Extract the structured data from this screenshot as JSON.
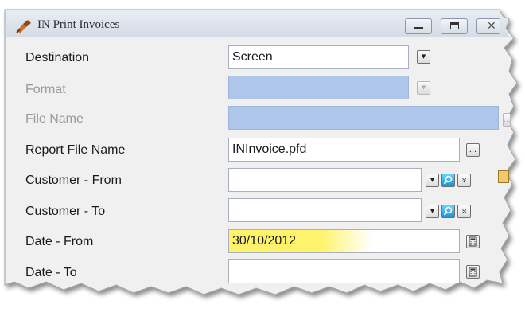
{
  "window": {
    "title": "IN Print Invoices",
    "icons": {
      "app": "satellite-icon",
      "minimize": "minimize-icon",
      "maximize": "maximize-icon",
      "close": "close-icon"
    }
  },
  "form": {
    "destination": {
      "label": "Destination",
      "value": "Screen"
    },
    "format": {
      "label": "Format",
      "value": ""
    },
    "file_name": {
      "label": "File Name",
      "value": ""
    },
    "report_file_name": {
      "label": "Report File Name",
      "value": "INInvoice.pfd"
    },
    "customer_from": {
      "label": "Customer - From",
      "value": ""
    },
    "customer_to": {
      "label": "Customer - To",
      "value": ""
    },
    "date_from": {
      "label": "Date - From",
      "value": "30/10/2012"
    },
    "date_to": {
      "label": "Date - To",
      "value": ""
    }
  },
  "glyphs": {
    "ellipsis": "...",
    "dropdown": "▾",
    "expand": "»"
  },
  "colors": {
    "disabled_field": "#aec6e9",
    "highlight": "#fff36b"
  }
}
